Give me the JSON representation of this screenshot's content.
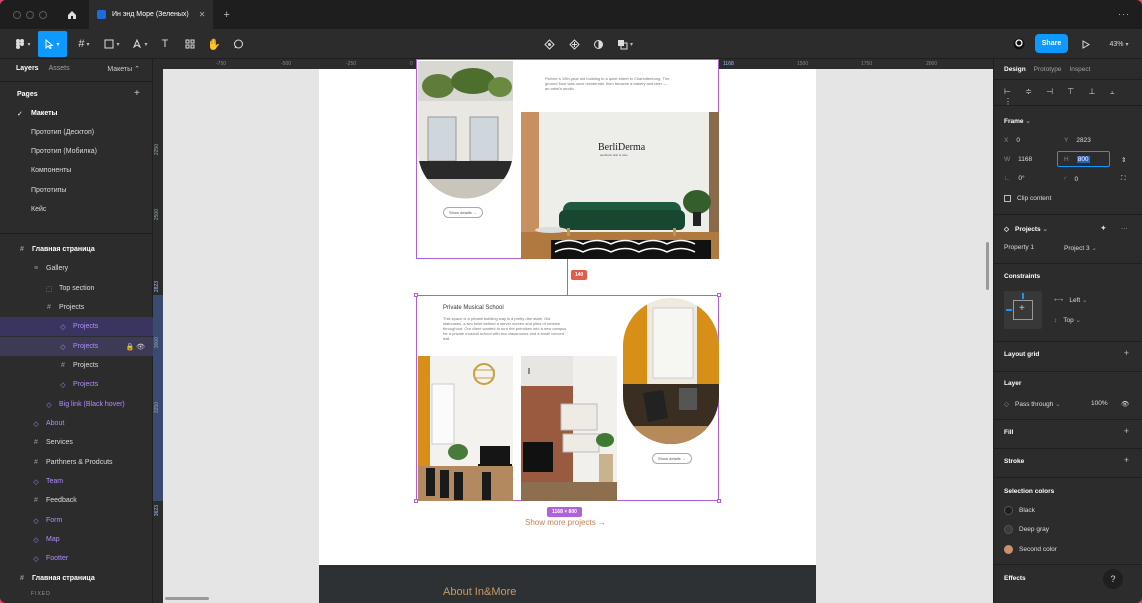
{
  "window": {
    "tab_title": "Ин энд Море (Зеленых)",
    "more_label": "···"
  },
  "toolbar": {
    "share_label": "Share",
    "zoom": "43%"
  },
  "left_panel": {
    "tabs": [
      "Layers",
      "Assets"
    ],
    "page_selector": "Макеты",
    "pages_title": "Pages",
    "pages": [
      "Макеты",
      "Прототип (Десктоп)",
      "Прототип (Мобилка)",
      "Компоненты",
      "Прототипы",
      "Кейс"
    ],
    "layers": [
      {
        "label": "Главная страница",
        "icon": "#",
        "kind": "frame"
      },
      {
        "label": "Gallery",
        "icon": "≡",
        "kind": "frame"
      },
      {
        "label": "Top section",
        "icon": "⬚",
        "kind": "frame"
      },
      {
        "label": "Projects",
        "icon": "#",
        "kind": "frame"
      },
      {
        "label": "Projects",
        "icon": "◇",
        "kind": "comp"
      },
      {
        "label": "Projects",
        "icon": "◇",
        "kind": "comp"
      },
      {
        "label": "Projects",
        "icon": "#",
        "kind": "frame"
      },
      {
        "label": "Projects",
        "icon": "◇",
        "kind": "comp"
      },
      {
        "label": "Big link (Black hover)",
        "icon": "◇",
        "kind": "comp"
      },
      {
        "label": "About",
        "icon": "◇",
        "kind": "comp"
      },
      {
        "label": "Services",
        "icon": "#",
        "kind": "frame"
      },
      {
        "label": "Parthners & Prodcuts",
        "icon": "#",
        "kind": "frame"
      },
      {
        "label": "Team",
        "icon": "◇",
        "kind": "comp"
      },
      {
        "label": "Feedback",
        "icon": "#",
        "kind": "frame"
      },
      {
        "label": "Form",
        "icon": "◇",
        "kind": "comp"
      },
      {
        "label": "Map",
        "icon": "◇",
        "kind": "comp"
      },
      {
        "label": "Footter",
        "icon": "◇",
        "kind": "comp"
      },
      {
        "label": "Главная страница",
        "icon": "#",
        "kind": "frame"
      }
    ],
    "fixed_label": "FIXED"
  },
  "canvas": {
    "ruler_top": [
      "-750",
      "-500",
      "-250",
      "0",
      "250",
      "500",
      "750",
      "1000",
      "1168",
      "1500",
      "1750",
      "2000"
    ],
    "ruler_left": [
      "2250",
      "2500",
      "2823",
      "3000",
      "3250",
      "3623"
    ],
    "project1": {
      "desc": "Picture a 10th-year old building in a quiet street in Charlottenburg. The ground floor was once residential, then became a bakery and later — an artist's studio.",
      "logo": "BerliDerma",
      "logo_sub": "aesthetic skin & care",
      "button": "Show details →"
    },
    "project2": {
      "title": "Private Musical School",
      "desc": "This space is a private building way is a pretty dire state. Old staircases, a two toilet behind a server screen and piles of rubbish throughout. Our client wanted to turn the premises into a new campus for a private musical school with two classrooms and a small concert hall.",
      "button": "Show details →"
    },
    "spacing_badge": "140",
    "size_badge": "1168 × 800",
    "show_more": "Show more projects →",
    "about_title": "About In&More"
  },
  "right_panel": {
    "tabs": [
      "Design",
      "Prototype",
      "Inspect"
    ],
    "frame_title": "Frame",
    "x": "0",
    "y": "2823",
    "w": "1168",
    "h": "800",
    "rotation": "0°",
    "radius": "0",
    "clip_content": "Clip content",
    "component_name": "Projects",
    "property_label": "Property 1",
    "property_value": "Project 3",
    "constraints_title": "Constraints",
    "constraint_h": "Left",
    "constraint_v": "Top",
    "layout_grid": "Layout grid",
    "layer_title": "Layer",
    "blend": "Pass through",
    "opacity": "100%",
    "fill": "Fill",
    "stroke": "Stroke",
    "selection_colors_title": "Selection colors",
    "colors": [
      {
        "name": "Black",
        "hex": "#1e1e1e"
      },
      {
        "name": "Deep gray",
        "hex": "#3c3c3c"
      },
      {
        "name": "Second color",
        "hex": "#c8916a"
      }
    ],
    "effects": "Effects",
    "help": "?"
  },
  "colors": {
    "accent": "#0d99ff",
    "selection": "#b060d8",
    "spacing": "#e15c4a"
  }
}
